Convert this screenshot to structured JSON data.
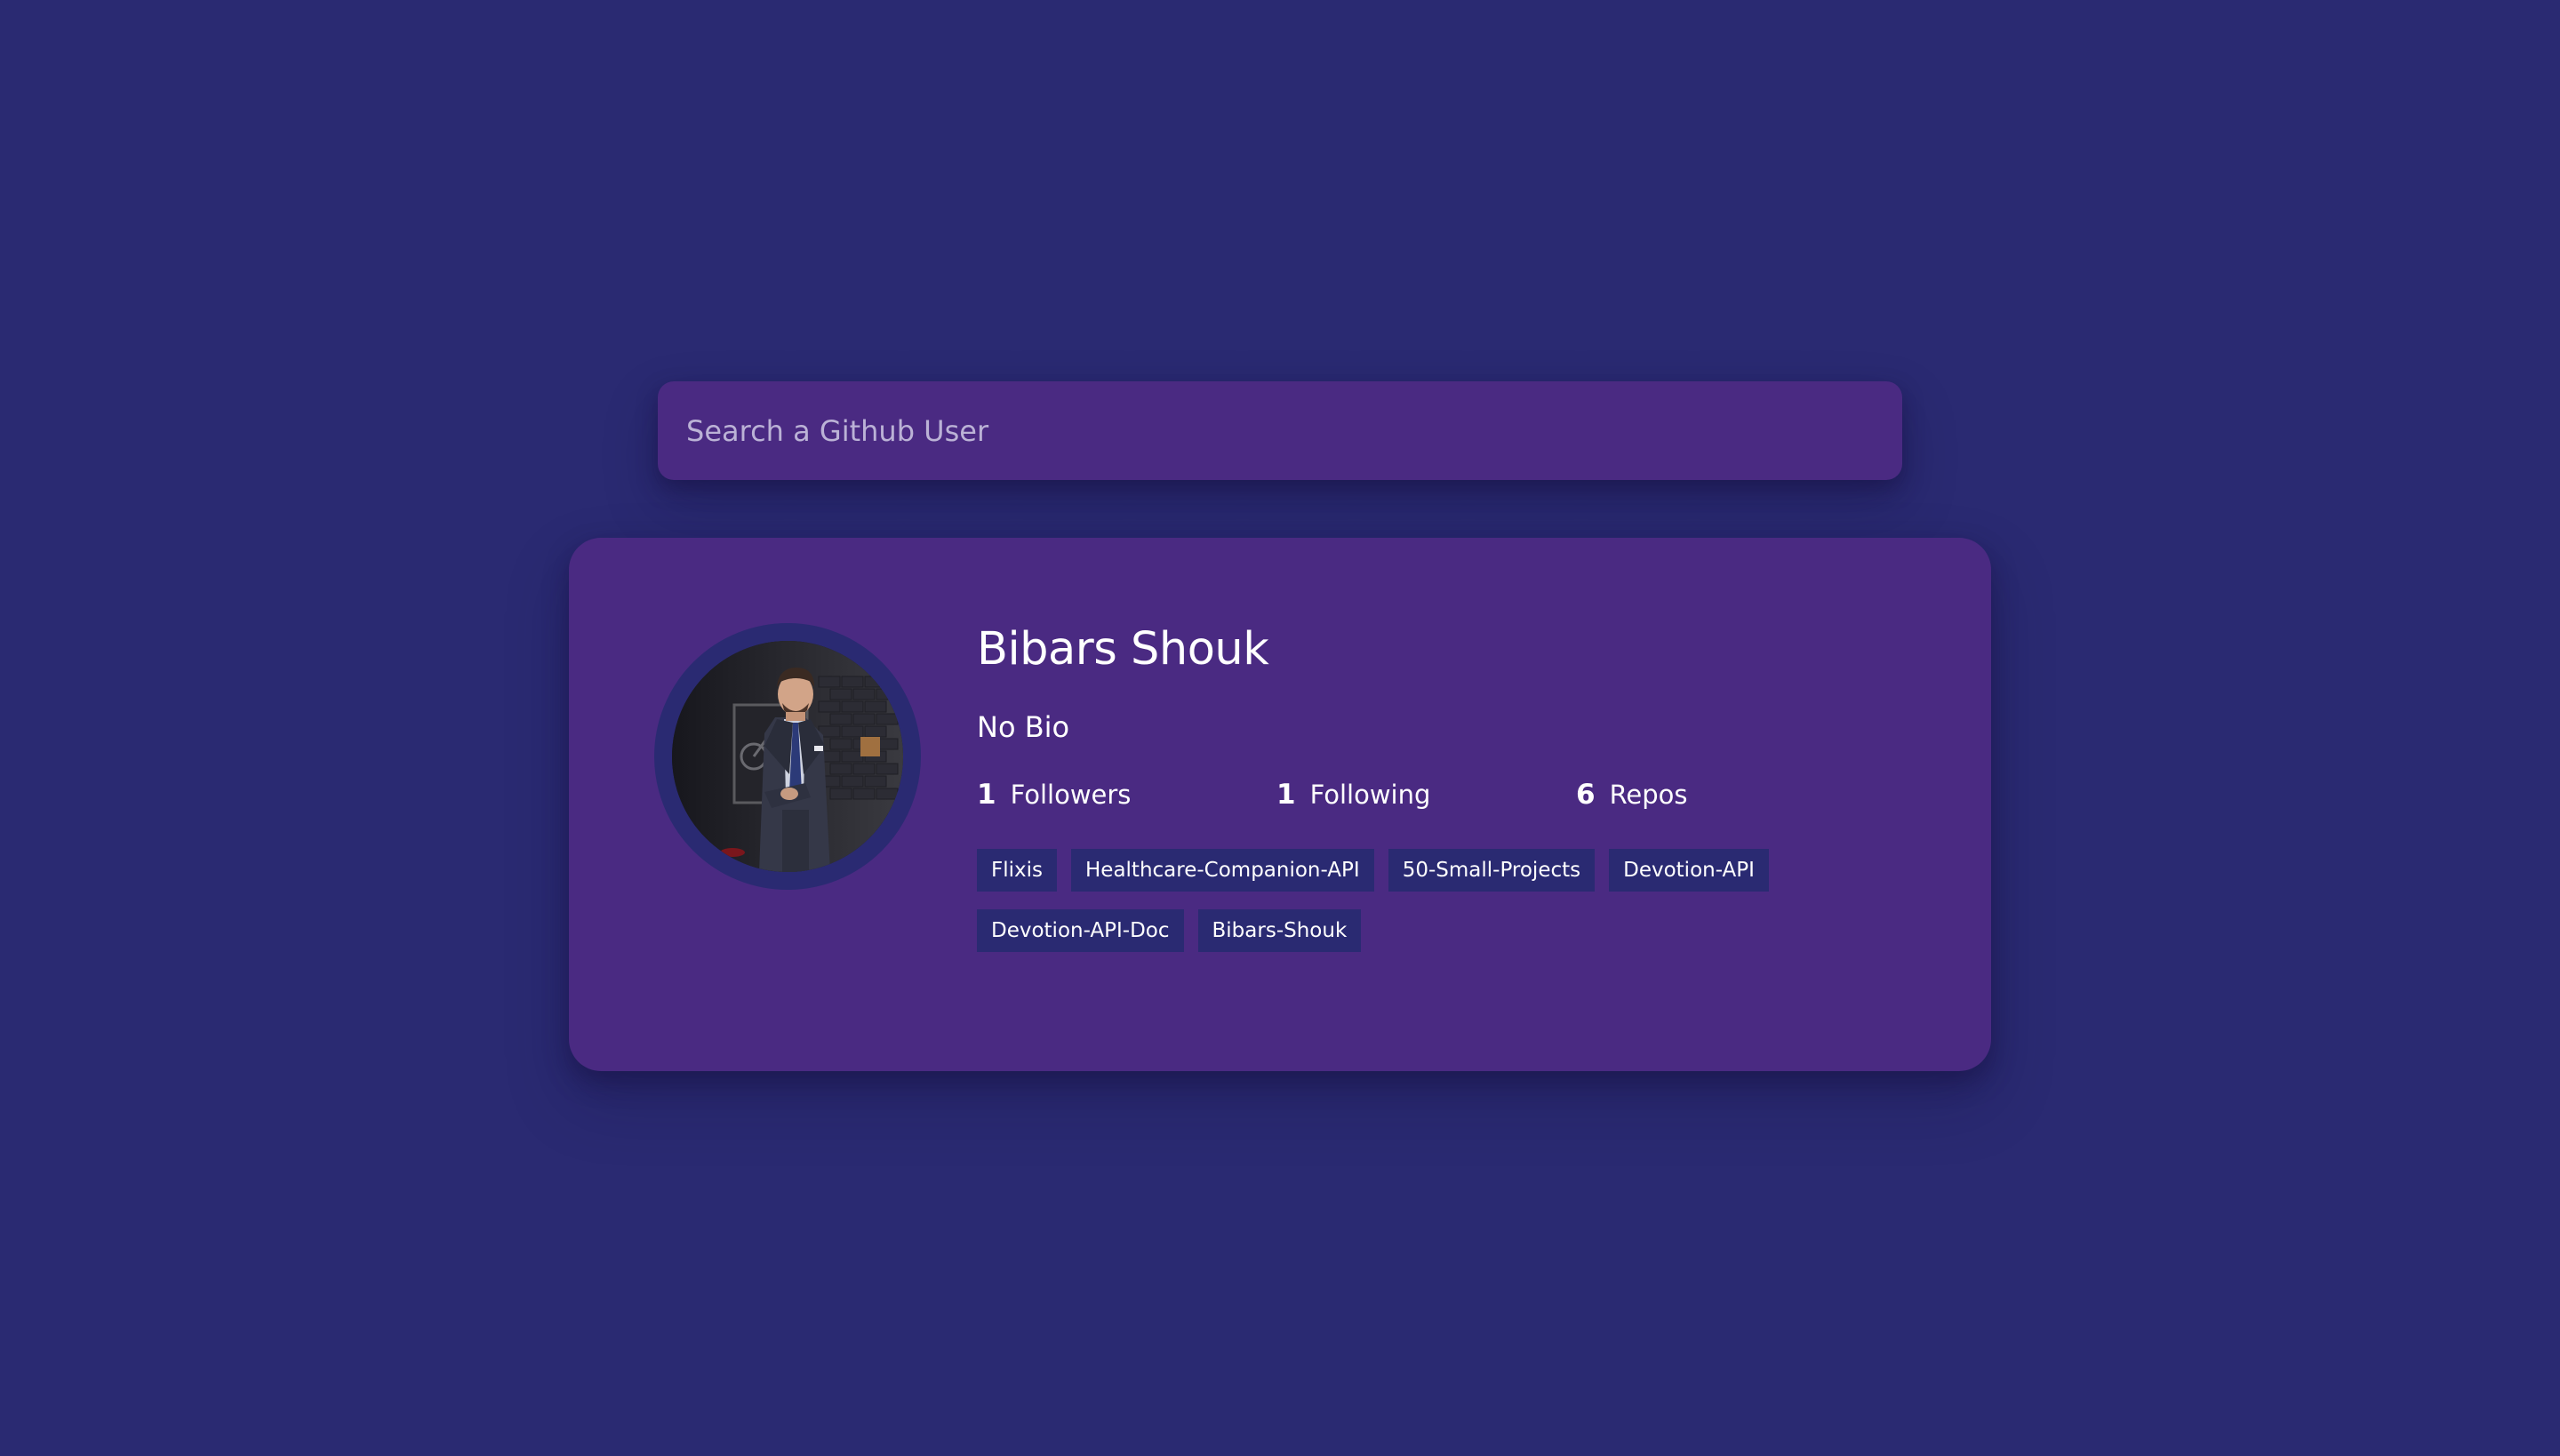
{
  "search": {
    "placeholder": "Search a Github User",
    "value": ""
  },
  "profile": {
    "avatar_alt": "Bibars Shouk",
    "name": "Bibars Shouk",
    "bio": "No Bio",
    "stats": [
      {
        "count": "1",
        "label": "Followers"
      },
      {
        "count": "1",
        "label": "Following"
      },
      {
        "count": "6",
        "label": "Repos"
      }
    ],
    "repos": [
      "Flixis",
      "Healthcare-Companion-API",
      "50-Small-Projects",
      "Devotion-API",
      "Devotion-API-Doc",
      "Bibars-Shouk"
    ]
  },
  "colors": {
    "background": "#2a2a72",
    "card": "#4a2a82",
    "repo_tag": "#2a2a72",
    "text": "#ffffff",
    "placeholder": "#bbb2d6"
  }
}
